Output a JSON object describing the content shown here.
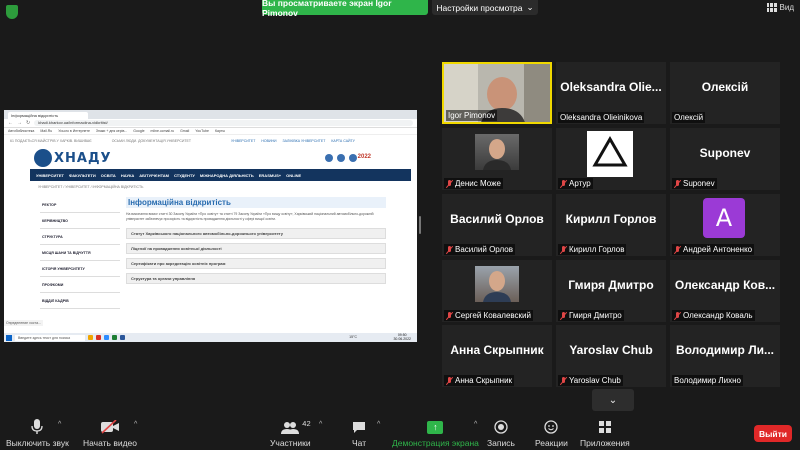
{
  "top": {
    "share_banner": "Вы просматриваете экран Igor Pimonov",
    "view_settings": "Настройки просмотра",
    "view_button": "Вид"
  },
  "shared_screen": {
    "tab_title": "Інформаційна відкритість",
    "url": "khadi.kharkov.ua/informaciina-vidkritist/",
    "bookmarks": [
      "Автобиблиотека",
      "Mail.Ru",
      "Усього в Интернете",
      "Знаки + дня керів...",
      "Google",
      "mline.ucmail.ru",
      "Gmail",
      "YouTube",
      "Карты"
    ],
    "site_top": [
      "61 ПОДАЄТЬСЯ МАЙСТРІВ У ХАРКІВ. ВИШИВАЄ",
      "ОСЬМИ ЛЮДИ. ДОКУМЕНТАЦІЯ УНІВЕРСИТЕТ"
    ],
    "site_top_links": [
      "УНІВЕРСИТЕТ",
      "НОВИНИ",
      "ЗАЛІКІВКА УНІВЕРСИТЕТ",
      "КАРТА САЙТУ"
    ],
    "logo_text": "ХНАДУ",
    "year": "2022",
    "nav": [
      "УНІВЕРСИТЕТ",
      "ФАКУЛЬТЕТИ",
      "ОСВІТА",
      "НАУКА",
      "АБІТУРІЄНТАМ",
      "СТУДЕНТУ",
      "МІЖНАРОДНА ДІЯЛЬНІСТЬ",
      "ERASMUS+",
      "ONLINE"
    ],
    "breadcrumb": "УНІВЕРСИТЕТ / УНІВЕРСИТЕТ / ІНФОРМАЦІЙНА ВІДКРИТІСТЬ",
    "side_menu": [
      "РЕКТОР",
      "КЕРІВНИЦТВО",
      "СТРУКТУРА",
      "МІСЦЯ ШАНИ ТА ВІДЧУТТЯ",
      "ІСТОРІЯ УНІВЕРСИТЕТУ",
      "ПРОФКОМИ",
      "ВІДДІЛ КАДРІВ"
    ],
    "content_title": "Інформаційна відкритість",
    "content_text": "На виконання вимог статті 30 Закону України «Про освіту» та статті 79 Закону України «Про вищу освіту», Харківський національний автомобільно-дорожній університет забезпечує прозорість та відкритість провадження діяльності у сфері вищої освіти.",
    "accordion": [
      "Статут Харківського національного автомобільно-дорожнього університету",
      "Ліцензії на провадження освітньої діяльності",
      "Сертифікати про акредитацію освітніх програм",
      "Структура та органи управління"
    ],
    "status_line": "Определение хоста...",
    "taskbar_search": "Введите здесь текст для поиска",
    "taskbar_temp": "15°C",
    "taskbar_time": "09:50",
    "taskbar_date": "30.06.2022"
  },
  "participants": [
    {
      "name": "Igor Pimonov",
      "label": "Igor Pimonov",
      "muted": false,
      "kind": "video"
    },
    {
      "name": "Oleksandra  Olie...",
      "label": "Oleksandra Olieinikova",
      "muted": false,
      "kind": "name"
    },
    {
      "name": "Олексій",
      "label": "Олексій",
      "muted": false,
      "kind": "name"
    },
    {
      "name": "",
      "label": "Денис Може",
      "muted": true,
      "kind": "photo"
    },
    {
      "name": "",
      "label": "Артур",
      "muted": true,
      "kind": "logo"
    },
    {
      "name": "Suponev",
      "label": "Suponev",
      "muted": true,
      "kind": "name"
    },
    {
      "name": "Василий Орлов",
      "label": "Василий Орлов",
      "muted": true,
      "kind": "name"
    },
    {
      "name": "Кирилл Горлов",
      "label": "Кирилл Горлов",
      "muted": true,
      "kind": "name"
    },
    {
      "name": "A",
      "label": "Андрей Антоненко",
      "muted": true,
      "kind": "letter"
    },
    {
      "name": "",
      "label": "Сергей Ковалевский",
      "muted": true,
      "kind": "photo"
    },
    {
      "name": "Гмиря Дмитро",
      "label": "Гмиря Дмитро",
      "muted": true,
      "kind": "name"
    },
    {
      "name": "Олександр  Ков...",
      "label": "Олександр Коваль",
      "muted": true,
      "kind": "name"
    },
    {
      "name": "Анна Скрыпник",
      "label": "Анна Скрыпник",
      "muted": true,
      "kind": "name"
    },
    {
      "name": "Yaroslav Chub",
      "label": "Yaroslav Chub",
      "muted": true,
      "kind": "name"
    },
    {
      "name": "Володимир  Ли...",
      "label": "Володимир Лихно",
      "muted": false,
      "kind": "name"
    }
  ],
  "toolbar": {
    "mute": "Выключить звук",
    "video": "Начать видео",
    "participants": "Участники",
    "participants_count": "42",
    "chat": "Чат",
    "share": "Демонстрация экрана",
    "record": "Запись",
    "reactions": "Реакции",
    "apps": "Приложения",
    "leave": "Выйти"
  },
  "colors": {
    "share_green": "#2fb54a",
    "leave_red": "#e02828",
    "active_speaker": "#f0d800",
    "avatar_purple": "#9b3ad6",
    "site_nav": "#13345e"
  }
}
